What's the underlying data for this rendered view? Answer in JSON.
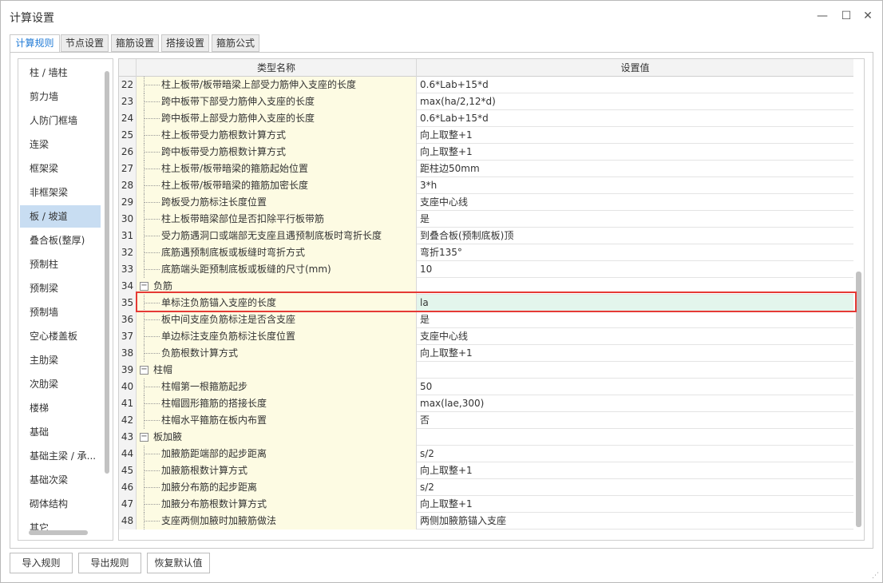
{
  "window": {
    "title": "计算设置",
    "minimize_glyph": "—",
    "maximize_glyph": "☐",
    "close_glyph": "✕"
  },
  "tabs": [
    {
      "label": "计算规则",
      "active": true
    },
    {
      "label": "节点设置",
      "active": false
    },
    {
      "label": "箍筋设置",
      "active": false
    },
    {
      "label": "搭接设置",
      "active": false
    },
    {
      "label": "箍筋公式",
      "active": false
    }
  ],
  "sidebar": {
    "items": [
      {
        "label": "柱 / 墙柱",
        "active": false
      },
      {
        "label": "剪力墙",
        "active": false
      },
      {
        "label": "人防门框墙",
        "active": false
      },
      {
        "label": "连梁",
        "active": false
      },
      {
        "label": "框架梁",
        "active": false
      },
      {
        "label": "非框架梁",
        "active": false
      },
      {
        "label": "板 / 坡道",
        "active": true
      },
      {
        "label": "叠合板(整厚)",
        "active": false
      },
      {
        "label": "预制柱",
        "active": false
      },
      {
        "label": "预制梁",
        "active": false
      },
      {
        "label": "预制墙",
        "active": false
      },
      {
        "label": "空心楼盖板",
        "active": false
      },
      {
        "label": "主肋梁",
        "active": false
      },
      {
        "label": "次肋梁",
        "active": false
      },
      {
        "label": "楼梯",
        "active": false
      },
      {
        "label": "基础",
        "active": false
      },
      {
        "label": "基础主梁 / 承...",
        "active": false
      },
      {
        "label": "基础次梁",
        "active": false
      },
      {
        "label": "砌体结构",
        "active": false
      },
      {
        "label": "其它",
        "active": false
      }
    ]
  },
  "grid": {
    "headers": {
      "name": "类型名称",
      "value": "设置值"
    },
    "rows": [
      {
        "num": "22",
        "type": "item",
        "name": "柱上板带/板带暗梁上部受力筋伸入支座的长度",
        "value": "0.6*Lab+15*d"
      },
      {
        "num": "23",
        "type": "item",
        "name": "跨中板带下部受力筋伸入支座的长度",
        "value": "max(ha/2,12*d)"
      },
      {
        "num": "24",
        "type": "item",
        "name": "跨中板带上部受力筋伸入支座的长度",
        "value": "0.6*Lab+15*d"
      },
      {
        "num": "25",
        "type": "item",
        "name": "柱上板带受力筋根数计算方式",
        "value": "向上取整+1"
      },
      {
        "num": "26",
        "type": "item",
        "name": "跨中板带受力筋根数计算方式",
        "value": "向上取整+1"
      },
      {
        "num": "27",
        "type": "item",
        "name": "柱上板带/板带暗梁的箍筋起始位置",
        "value": "距柱边50mm"
      },
      {
        "num": "28",
        "type": "item",
        "name": "柱上板带/板带暗梁的箍筋加密长度",
        "value": "3*h"
      },
      {
        "num": "29",
        "type": "item",
        "name": "跨板受力筋标注长度位置",
        "value": "支座中心线"
      },
      {
        "num": "30",
        "type": "item",
        "name": "柱上板带暗梁部位是否扣除平行板带筋",
        "value": "是"
      },
      {
        "num": "31",
        "type": "item",
        "name": "受力筋遇洞口或端部无支座且遇预制底板时弯折长度",
        "value": "到叠合板(预制底板)顶"
      },
      {
        "num": "32",
        "type": "item",
        "name": "底筋遇预制底板或板缝时弯折方式",
        "value": "弯折135°"
      },
      {
        "num": "33",
        "type": "item",
        "name": "底筋端头距预制底板或板缝的尺寸(mm)",
        "value": "10"
      },
      {
        "num": "34",
        "type": "group",
        "name": "负筋",
        "value": ""
      },
      {
        "num": "35",
        "type": "item",
        "name": "单标注负筋锚入支座的长度",
        "value": "la",
        "selected": true
      },
      {
        "num": "36",
        "type": "item",
        "name": "板中间支座负筋标注是否含支座",
        "value": "是"
      },
      {
        "num": "37",
        "type": "item",
        "name": "单边标注支座负筋标注长度位置",
        "value": "支座中心线"
      },
      {
        "num": "38",
        "type": "item",
        "name": "负筋根数计算方式",
        "value": "向上取整+1"
      },
      {
        "num": "39",
        "type": "group",
        "name": "柱帽",
        "value": ""
      },
      {
        "num": "40",
        "type": "item",
        "name": "柱帽第一根箍筋起步",
        "value": "50"
      },
      {
        "num": "41",
        "type": "item",
        "name": "柱帽圆形箍筋的搭接长度",
        "value": "max(lae,300)"
      },
      {
        "num": "42",
        "type": "item",
        "name": "柱帽水平箍筋在板内布置",
        "value": "否"
      },
      {
        "num": "43",
        "type": "group",
        "name": "板加腋",
        "value": ""
      },
      {
        "num": "44",
        "type": "item",
        "name": "加腋筋距端部的起步距离",
        "value": "s/2"
      },
      {
        "num": "45",
        "type": "item",
        "name": "加腋筋根数计算方式",
        "value": "向上取整+1"
      },
      {
        "num": "46",
        "type": "item",
        "name": "加腋分布筋的起步距离",
        "value": "s/2"
      },
      {
        "num": "47",
        "type": "item",
        "name": "加腋分布筋根数计算方式",
        "value": "向上取整+1"
      },
      {
        "num": "48",
        "type": "item",
        "name": "支座两侧加腋时加腋筋做法",
        "value": "两侧加腋筋锚入支座"
      }
    ]
  },
  "footer": {
    "import_label": "导入规则",
    "export_label": "导出规则",
    "restore_label": "恢复默认值"
  },
  "colors": {
    "accent": "#1f7ad6",
    "highlight_border": "#e53935",
    "name_column_bg": "#fdfbe3",
    "selected_value_bg": "#e3f5ec",
    "sidebar_active_bg": "#c8ddf2"
  }
}
